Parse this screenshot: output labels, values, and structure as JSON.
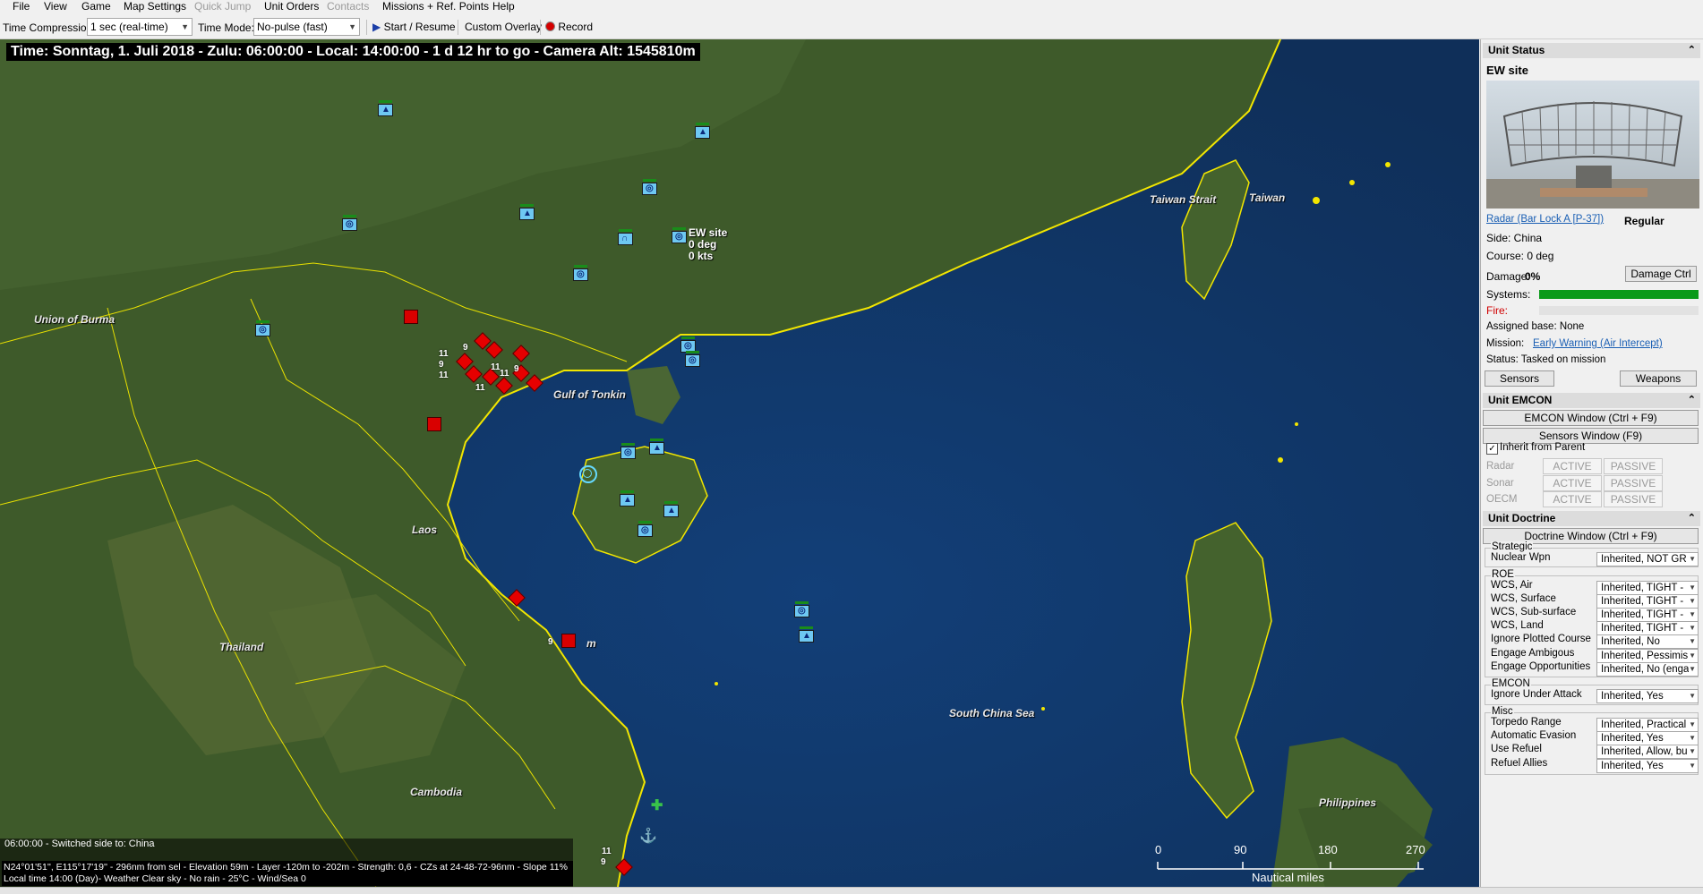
{
  "menu": [
    "File",
    "View",
    "Game",
    "Map Settings",
    "Quick Jump",
    "Unit Orders",
    "Contacts",
    "Missions + Ref. Points",
    "Help"
  ],
  "menu_disabled": [
    "Quick Jump",
    "Contacts"
  ],
  "toolbar": {
    "time_compression_label": "Time Compression:",
    "time_compression_value": "1 sec (real-time)",
    "time_mode_label": "Time Mode:",
    "time_mode_value": "No-pulse (fast)",
    "start_label": "Start / Resume",
    "overlay_label": "Custom Overlay",
    "record_label": "Record"
  },
  "map": {
    "time_bar": "Time: Sonntag, 1. Juli 2018 - Zulu: 06:00:00 - Local: 14:00:00 - 1 d 12 hr to go -  Camera Alt: 1545810m",
    "labels": {
      "burma": "Union of Burma",
      "tonkin": "Gulf of Tonkin",
      "laos": "Laos",
      "thailand": "Thailand",
      "cambodia": "Cambodia",
      "scs": "South China Sea",
      "taiwan_strait": "Taiwan Strait",
      "taiwan": "Taiwan",
      "philippines": "Philippines",
      "vietnam_partial": "m"
    },
    "selected_unit": {
      "name": "EW site",
      "heading": "0 deg",
      "speed": "0 kts"
    },
    "hostile_numbers": [
      "11",
      "9",
      "9",
      "11",
      "9",
      "11",
      "11",
      "11",
      "9",
      "11",
      "9"
    ],
    "message": "06:00:00 - Switched side to: China",
    "info_line1": "N24°01'51'', E115°17'19'' - 296nm from sel - Elevation 59m - Layer -120m to -202m - Strength: 0,6 - CZs at 24-48-72-96nm - Slope 11%",
    "info_line2": "Local time 14:00 (Day)- Weather Clear sky - No rain - 25°C - Wind/Sea 0",
    "scale": {
      "ticks": [
        "0",
        "90",
        "180",
        "270"
      ],
      "unit": "Nautical miles"
    },
    "colors": {
      "ocean": "#123a6a",
      "land": "#3e5a2a",
      "coast": "#f2e600",
      "border": "#e8e000",
      "friendly": "#6ec8f2",
      "hostile": "#e60000"
    }
  },
  "panel": {
    "unit_status": {
      "header": "Unit Status",
      "name": "EW site",
      "type_link": "Radar (Bar Lock A [P-37])",
      "proficiency": "Regular",
      "side": "Side: China",
      "course": "Course: 0 deg",
      "damage_label": "Damage:",
      "damage_value": "0%",
      "damage_ctrl": "Damage Ctrl",
      "systems_label": "Systems:",
      "systems_fraction": 1.0,
      "fire_label": "Fire:",
      "fire_fraction": 0.0,
      "assigned_base": "Assigned base: None",
      "mission_label": "Mission:",
      "mission_link": "Early Warning (Air Intercept)",
      "status": "Status: Tasked on mission",
      "sensors_btn": "Sensors",
      "weapons_btn": "Weapons"
    },
    "emcon": {
      "header": "Unit EMCON",
      "window_btn": "EMCON Window (Ctrl + F9)",
      "sensors_btn": "Sensors Window (F9)",
      "inherit": "Inherit from Parent",
      "inherit_checked": true,
      "rows": [
        {
          "label": "Radar",
          "active": "ACTIVE",
          "passive": "PASSIVE"
        },
        {
          "label": "Sonar",
          "active": "ACTIVE",
          "passive": "PASSIVE"
        },
        {
          "label": "OECM",
          "active": "ACTIVE",
          "passive": "PASSIVE"
        }
      ]
    },
    "doctrine": {
      "header": "Unit Doctrine",
      "window_btn": "Doctrine Window (Ctrl + F9)",
      "groups": [
        {
          "title": "Strategic",
          "rows": [
            {
              "label": "Nuclear Wpn",
              "value": "Inherited, NOT GR"
            }
          ]
        },
        {
          "title": "ROE",
          "rows": [
            {
              "label": "WCS, Air",
              "value": "Inherited, TIGHT -"
            },
            {
              "label": "WCS, Surface",
              "value": "Inherited, TIGHT -"
            },
            {
              "label": "WCS, Sub-surface",
              "value": "Inherited, TIGHT -"
            },
            {
              "label": "WCS, Land",
              "value": "Inherited, TIGHT -"
            },
            {
              "label": "Ignore Plotted Course",
              "value": "Inherited, No"
            },
            {
              "label": "Engage Ambigous",
              "value": "Inherited, Pessimis"
            },
            {
              "label": "Engage Opportunities",
              "value": "Inherited, No (enga"
            }
          ]
        },
        {
          "title": "EMCON",
          "rows": [
            {
              "label": "Ignore Under Attack",
              "value": "Inherited, Yes"
            }
          ]
        },
        {
          "title": "Misc",
          "rows": [
            {
              "label": "Torpedo Range",
              "value": "Inherited, Practical"
            },
            {
              "label": "Automatic Evasion",
              "value": "Inherited, Yes"
            },
            {
              "label": "Use Refuel",
              "value": "Inherited, Allow, bu"
            },
            {
              "label": "Refuel Allies",
              "value": "Inherited, Yes"
            }
          ]
        }
      ]
    }
  }
}
